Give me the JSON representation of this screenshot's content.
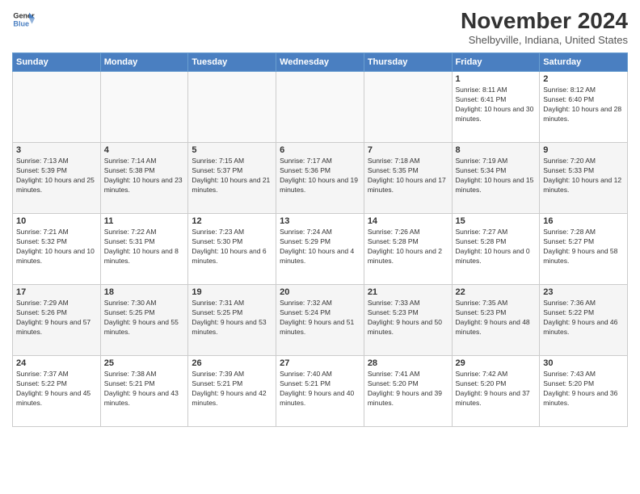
{
  "header": {
    "logo_line1": "General",
    "logo_line2": "Blue",
    "month_title": "November 2024",
    "location": "Shelbyville, Indiana, United States"
  },
  "days_of_week": [
    "Sunday",
    "Monday",
    "Tuesday",
    "Wednesday",
    "Thursday",
    "Friday",
    "Saturday"
  ],
  "weeks": [
    [
      {
        "num": "",
        "empty": true
      },
      {
        "num": "",
        "empty": true
      },
      {
        "num": "",
        "empty": true
      },
      {
        "num": "",
        "empty": true
      },
      {
        "num": "",
        "empty": true
      },
      {
        "num": "1",
        "sunrise": "8:11 AM",
        "sunset": "6:41 PM",
        "daylight": "10 hours and 30 minutes."
      },
      {
        "num": "2",
        "sunrise": "8:12 AM",
        "sunset": "6:40 PM",
        "daylight": "10 hours and 28 minutes."
      }
    ],
    [
      {
        "num": "3",
        "sunrise": "7:13 AM",
        "sunset": "5:39 PM",
        "daylight": "10 hours and 25 minutes."
      },
      {
        "num": "4",
        "sunrise": "7:14 AM",
        "sunset": "5:38 PM",
        "daylight": "10 hours and 23 minutes."
      },
      {
        "num": "5",
        "sunrise": "7:15 AM",
        "sunset": "5:37 PM",
        "daylight": "10 hours and 21 minutes."
      },
      {
        "num": "6",
        "sunrise": "7:17 AM",
        "sunset": "5:36 PM",
        "daylight": "10 hours and 19 minutes."
      },
      {
        "num": "7",
        "sunrise": "7:18 AM",
        "sunset": "5:35 PM",
        "daylight": "10 hours and 17 minutes."
      },
      {
        "num": "8",
        "sunrise": "7:19 AM",
        "sunset": "5:34 PM",
        "daylight": "10 hours and 15 minutes."
      },
      {
        "num": "9",
        "sunrise": "7:20 AM",
        "sunset": "5:33 PM",
        "daylight": "10 hours and 12 minutes."
      }
    ],
    [
      {
        "num": "10",
        "sunrise": "7:21 AM",
        "sunset": "5:32 PM",
        "daylight": "10 hours and 10 minutes."
      },
      {
        "num": "11",
        "sunrise": "7:22 AM",
        "sunset": "5:31 PM",
        "daylight": "10 hours and 8 minutes."
      },
      {
        "num": "12",
        "sunrise": "7:23 AM",
        "sunset": "5:30 PM",
        "daylight": "10 hours and 6 minutes."
      },
      {
        "num": "13",
        "sunrise": "7:24 AM",
        "sunset": "5:29 PM",
        "daylight": "10 hours and 4 minutes."
      },
      {
        "num": "14",
        "sunrise": "7:26 AM",
        "sunset": "5:28 PM",
        "daylight": "10 hours and 2 minutes."
      },
      {
        "num": "15",
        "sunrise": "7:27 AM",
        "sunset": "5:28 PM",
        "daylight": "10 hours and 0 minutes."
      },
      {
        "num": "16",
        "sunrise": "7:28 AM",
        "sunset": "5:27 PM",
        "daylight": "9 hours and 58 minutes."
      }
    ],
    [
      {
        "num": "17",
        "sunrise": "7:29 AM",
        "sunset": "5:26 PM",
        "daylight": "9 hours and 57 minutes."
      },
      {
        "num": "18",
        "sunrise": "7:30 AM",
        "sunset": "5:25 PM",
        "daylight": "9 hours and 55 minutes."
      },
      {
        "num": "19",
        "sunrise": "7:31 AM",
        "sunset": "5:25 PM",
        "daylight": "9 hours and 53 minutes."
      },
      {
        "num": "20",
        "sunrise": "7:32 AM",
        "sunset": "5:24 PM",
        "daylight": "9 hours and 51 minutes."
      },
      {
        "num": "21",
        "sunrise": "7:33 AM",
        "sunset": "5:23 PM",
        "daylight": "9 hours and 50 minutes."
      },
      {
        "num": "22",
        "sunrise": "7:35 AM",
        "sunset": "5:23 PM",
        "daylight": "9 hours and 48 minutes."
      },
      {
        "num": "23",
        "sunrise": "7:36 AM",
        "sunset": "5:22 PM",
        "daylight": "9 hours and 46 minutes."
      }
    ],
    [
      {
        "num": "24",
        "sunrise": "7:37 AM",
        "sunset": "5:22 PM",
        "daylight": "9 hours and 45 minutes."
      },
      {
        "num": "25",
        "sunrise": "7:38 AM",
        "sunset": "5:21 PM",
        "daylight": "9 hours and 43 minutes."
      },
      {
        "num": "26",
        "sunrise": "7:39 AM",
        "sunset": "5:21 PM",
        "daylight": "9 hours and 42 minutes."
      },
      {
        "num": "27",
        "sunrise": "7:40 AM",
        "sunset": "5:21 PM",
        "daylight": "9 hours and 40 minutes."
      },
      {
        "num": "28",
        "sunrise": "7:41 AM",
        "sunset": "5:20 PM",
        "daylight": "9 hours and 39 minutes."
      },
      {
        "num": "29",
        "sunrise": "7:42 AM",
        "sunset": "5:20 PM",
        "daylight": "9 hours and 37 minutes."
      },
      {
        "num": "30",
        "sunrise": "7:43 AM",
        "sunset": "5:20 PM",
        "daylight": "9 hours and 36 minutes."
      }
    ]
  ]
}
